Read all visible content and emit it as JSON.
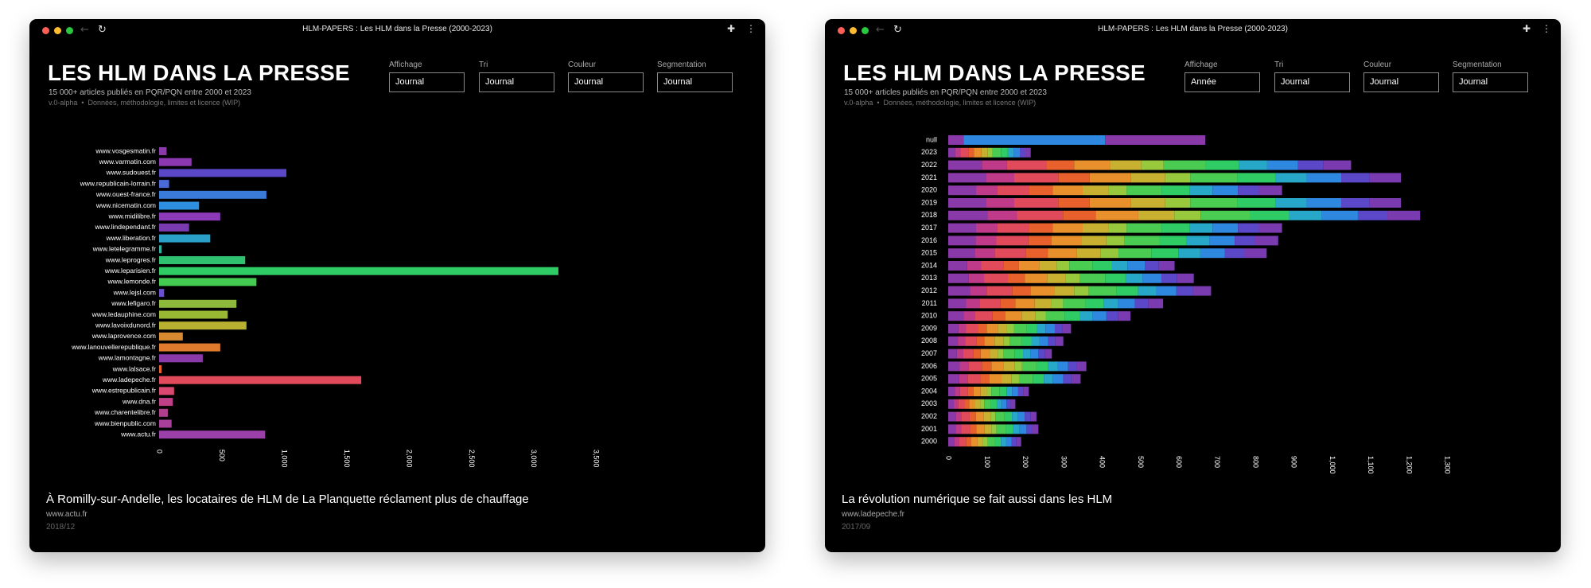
{
  "windows": [
    {
      "window_title": "HLM-PAPERS : Les HLM dans la Presse (2000-2023)",
      "app_title": "LES HLM DANS LA PRESSE",
      "subtitle": "15 000+ articles publiés en PQR/PQN entre 2000 et 2023",
      "version": "v.0-alpha",
      "meta_link": "Données, méthodologie, limites et licence (WIP)",
      "controls": [
        {
          "label": "Affichage",
          "value": "Journal"
        },
        {
          "label": "Tri",
          "value": "Journal"
        },
        {
          "label": "Couleur",
          "value": "Journal"
        },
        {
          "label": "Segmentation",
          "value": "Journal"
        }
      ],
      "article": {
        "title": "À Romilly-sur-Andelle, les locataires de HLM de La Planquette réclament plus de chauffage",
        "source": "www.actu.fr",
        "date": "2018/12"
      }
    },
    {
      "window_title": "HLM-PAPERS : Les HLM dans la Presse (2000-2023)",
      "app_title": "LES HLM DANS LA PRESSE",
      "subtitle": "15 000+ articles publiés en PQR/PQN entre 2000 et 2023",
      "version": "v.0-alpha",
      "meta_link": "Données, méthodologie, limites et licence (WIP)",
      "controls": [
        {
          "label": "Affichage",
          "value": "Année"
        },
        {
          "label": "Tri",
          "value": "Journal"
        },
        {
          "label": "Couleur",
          "value": "Journal"
        },
        {
          "label": "Segmentation",
          "value": "Journal"
        }
      ],
      "article": {
        "title": "La révolution numérique se fait aussi dans les HLM",
        "source": "www.ladepeche.fr",
        "date": "2017/09"
      }
    }
  ],
  "chart_data": [
    {
      "type": "bar",
      "orientation": "horizontal",
      "stacked": false,
      "categories": [
        "www.vosgesmatin.fr",
        "www.varmatin.com",
        "www.sudouest.fr",
        "www.republicain-lorrain.fr",
        "www.ouest-france.fr",
        "www.nicematin.com",
        "www.midilibre.fr",
        "www.lindependant.fr",
        "www.liberation.fr",
        "www.letelegramme.fr",
        "www.leprogres.fr",
        "www.leparisien.fr",
        "www.lemonde.fr",
        "www.lejsl.com",
        "www.lefigaro.fr",
        "www.ledauphine.com",
        "www.lavoixdunord.fr",
        "www.laprovence.com",
        "www.lanouvellerepublique.fr",
        "www.lamontagne.fr",
        "www.lalsace.fr",
        "www.ladepeche.fr",
        "www.estrepublicain.fr",
        "www.dna.fr",
        "www.charentelibre.fr",
        "www.bienpublic.com",
        "www.actu.fr"
      ],
      "values": [
        60,
        260,
        1020,
        80,
        860,
        320,
        490,
        240,
        410,
        20,
        690,
        3200,
        780,
        40,
        620,
        550,
        700,
        190,
        490,
        350,
        20,
        1620,
        120,
        110,
        70,
        100,
        850
      ],
      "colors": [
        "#8a3aa8",
        "#8c38b0",
        "#5a48c8",
        "#4a6ad8",
        "#3a7ad8",
        "#2e8ee0",
        "#8c3ab8",
        "#7a3ab0",
        "#2aa0c8",
        "#30b0a0",
        "#2fc070",
        "#2fcc66",
        "#44cc52",
        "#6a50d0",
        "#8cb83c",
        "#98b834",
        "#b8b030",
        "#d88a30",
        "#e07a2c",
        "#8a3aa8",
        "#e8602c",
        "#e04a5a",
        "#d84870",
        "#c04088",
        "#b0408e",
        "#a8409a",
        "#9a40a8"
      ],
      "xticks": [
        "0",
        "500",
        "1,000",
        "1,500",
        "2,000",
        "2,500",
        "3,000",
        "3,500"
      ],
      "xlim": [
        0,
        3500
      ],
      "grid": false,
      "legend": "none"
    },
    {
      "type": "bar",
      "orientation": "horizontal",
      "stacked": true,
      "categories": [
        "null",
        "2023",
        "2022",
        "2021",
        "2020",
        "2019",
        "2018",
        "2017",
        "2016",
        "2015",
        "2014",
        "2013",
        "2012",
        "2011",
        "2010",
        "2009",
        "2008",
        "2007",
        "2006",
        "2005",
        "2004",
        "2003",
        "2002",
        "2001",
        "2000"
      ],
      "totals": [
        670,
        215,
        1050,
        1180,
        870,
        1180,
        1230,
        870,
        860,
        830,
        590,
        640,
        685,
        560,
        475,
        320,
        300,
        270,
        360,
        345,
        210,
        175,
        230,
        235,
        190
      ],
      "xticks": [
        "0",
        "100",
        "200",
        "300",
        "400",
        "500",
        "600",
        "700",
        "800",
        "900",
        "1,000",
        "1,100",
        "1,200",
        "1,300"
      ],
      "xlim": [
        0,
        1300
      ],
      "grid": false,
      "legend": "none"
    }
  ]
}
